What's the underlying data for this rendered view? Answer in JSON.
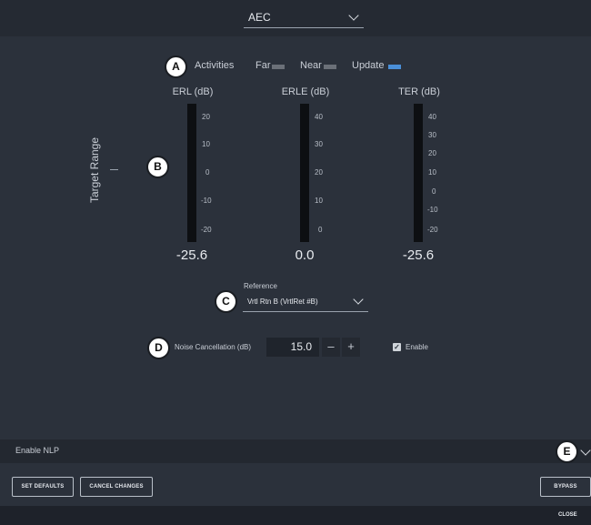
{
  "header": {
    "selector_value": "AEC"
  },
  "callouts": {
    "a": "A",
    "b": "B",
    "c": "C",
    "d": "D",
    "e": "E"
  },
  "activities": {
    "label": "Activities",
    "items": [
      {
        "label": "Far",
        "color": "#6b7078"
      },
      {
        "label": "Near",
        "color": "#6b7078"
      },
      {
        "label": "Update",
        "color": "#4a8fd8"
      }
    ]
  },
  "target_range": {
    "label": "Target Range"
  },
  "meters": [
    {
      "title": "ERL (dB)",
      "ticks": [
        "20",
        "10",
        "0",
        "-10",
        "-20"
      ],
      "value": "-25.6"
    },
    {
      "title": "ERLE (dB)",
      "ticks": [
        "40",
        "30",
        "20",
        "10",
        "0"
      ],
      "value": "0.0"
    },
    {
      "title": "TER (dB)",
      "ticks": [
        "40",
        "30",
        "20",
        "10",
        "0",
        "-10",
        "-20"
      ],
      "value": "-25.6"
    }
  ],
  "reference": {
    "label": "Reference",
    "value": "Vrtl Rtn B  (VrtlRet #B)"
  },
  "noise_cancellation": {
    "label": "Noise Cancellation (dB)",
    "value": "15.0",
    "minus": "–",
    "plus": "+",
    "enable_label": "Enable",
    "enable_checked": true
  },
  "nlp": {
    "label": "Enable NLP"
  },
  "buttons": {
    "set_defaults": "SET DEFAULTS",
    "cancel_changes": "CANCEL CHANGES",
    "bypass": "BYPASS"
  },
  "footer": {
    "close": "CLOSE"
  }
}
